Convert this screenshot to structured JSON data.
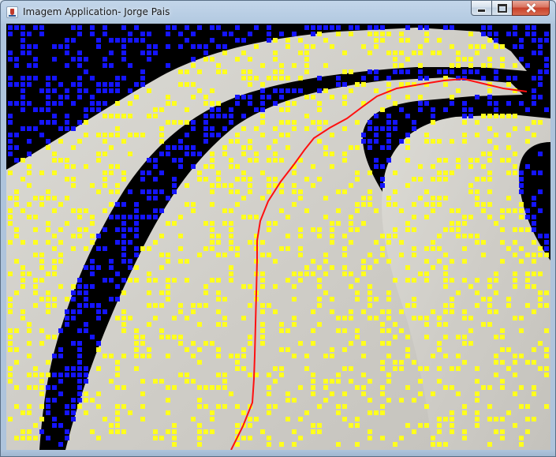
{
  "window": {
    "title": "Imagem Application- Jorge Pais"
  },
  "controls": {
    "minimize_icon": "minimize-icon",
    "maximize_icon": "maximize-icon",
    "close_icon": "close-icon"
  },
  "image": {
    "description_colors": {
      "background": "#000000",
      "blue_markers": "#1414ff",
      "yellow_markers": "#ffff1e",
      "path_line": "#ff1010",
      "surface": "#d2d0cb"
    }
  }
}
